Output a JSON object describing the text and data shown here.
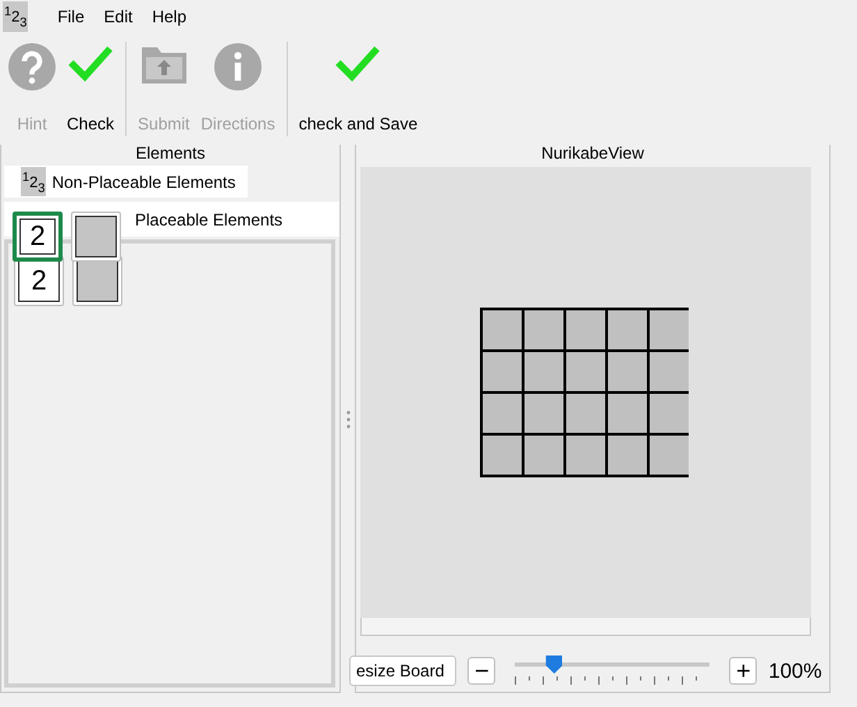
{
  "app_icon": "$^{1}$2$_{3}$",
  "menu": [
    "File",
    "Edit",
    "Help"
  ],
  "toolbar": [
    {
      "kind": "question",
      "label": "Hint",
      "disabled": true,
      "separator_after": false
    },
    {
      "kind": "check",
      "label": "Check",
      "disabled": false,
      "separator_after": true
    },
    {
      "kind": "upload",
      "label": "Submit",
      "disabled": true,
      "separator_after": false
    },
    {
      "kind": "info",
      "label": "Directions",
      "disabled": true,
      "separator_after": true
    },
    {
      "kind": "check",
      "label": "check and Save",
      "disabled": false,
      "separator_after": false
    }
  ],
  "elements_panel": {
    "title": "Elements",
    "tabs": [
      {
        "label": "Non-Placeable Elements",
        "icon": "$^{1}$2$_{3}$",
        "selected": false
      },
      {
        "label": "Placeable Elements",
        "selected": true
      }
    ],
    "tiles": [
      {
        "kind": "number",
        "text": "2",
        "selected": true
      },
      {
        "kind": "blank",
        "selected": false
      }
    ],
    "tiles_behind": [
      {
        "kind": "number",
        "text": "2",
        "selected": false
      },
      {
        "kind": "blank",
        "selected": false
      }
    ]
  },
  "board_panel": {
    "title": "NurikabeView",
    "board_rows": [
      [
        {
          "kind": "unknown"
        },
        {
          "kind": "unknown"
        },
        {
          "kind": "unknown"
        },
        {
          "kind": "unknown"
        },
        {
          "kind": "unknown"
        }
      ],
      [
        {
          "kind": "unknown"
        },
        {
          "kind": "unknown"
        },
        {
          "kind": "unknown"
        },
        {
          "kind": "unknown"
        },
        {
          "kind": "unknown"
        }
      ],
      [
        {
          "kind": "unknown"
        },
        {
          "kind": "unknown"
        },
        {
          "kind": "unknown"
        },
        {
          "kind": "unknown"
        },
        {
          "kind": "unknown"
        }
      ],
      [
        {
          "kind": "unknown"
        },
        {
          "kind": "unknown"
        },
        {
          "kind": "unknown"
        },
        {
          "kind": "unknown"
        },
        {
          "kind": "unknown"
        }
      ]
    ],
    "resize_button": "esize Board",
    "zoom": {
      "minus": "−",
      "plus": "+",
      "level": 0.2,
      "reading": "100%"
    }
  }
}
